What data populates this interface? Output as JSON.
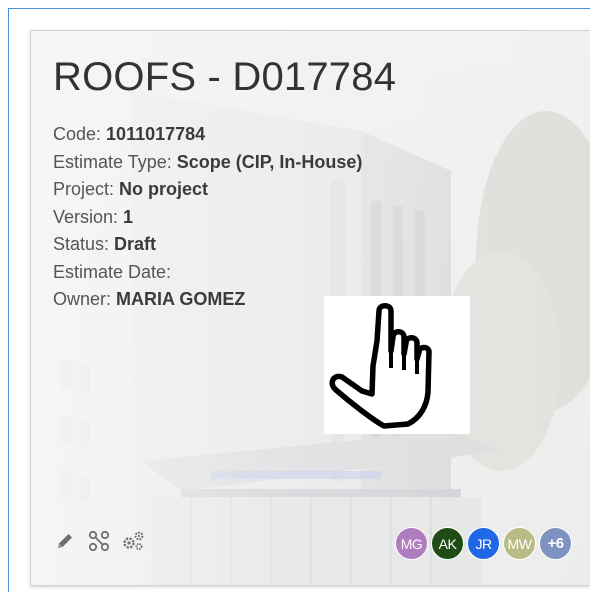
{
  "card": {
    "title": "ROOFS - D017784",
    "fields": [
      {
        "label": "Code: ",
        "value": "1011017784"
      },
      {
        "label": "Estimate Type: ",
        "value": "Scope (CIP, In-House)"
      },
      {
        "label": "Project: ",
        "value": "No project"
      },
      {
        "label": "Version: ",
        "value": "1"
      },
      {
        "label": "Status: ",
        "value": "Draft"
      },
      {
        "label": "Estimate Date: ",
        "value": ""
      },
      {
        "label": "Owner: ",
        "value": "MARIA GOMEZ"
      }
    ],
    "tools": [
      {
        "icon": "pencil-icon",
        "name": "edit-button"
      },
      {
        "icon": "workflow-icon",
        "name": "workflow-button"
      },
      {
        "icon": "gears-icon",
        "name": "settings-button"
      }
    ],
    "avatars": [
      {
        "initials": "MG",
        "color": "#b07cc0"
      },
      {
        "initials": "AK",
        "color": "#1f4c15"
      },
      {
        "initials": "JR",
        "color": "#1f67e6"
      },
      {
        "initials": "MW",
        "color": "#b9bc84"
      },
      {
        "initials": "+6",
        "color": "#7f93c0"
      }
    ]
  },
  "cursor": {
    "icon": "hand-pointer-icon"
  }
}
